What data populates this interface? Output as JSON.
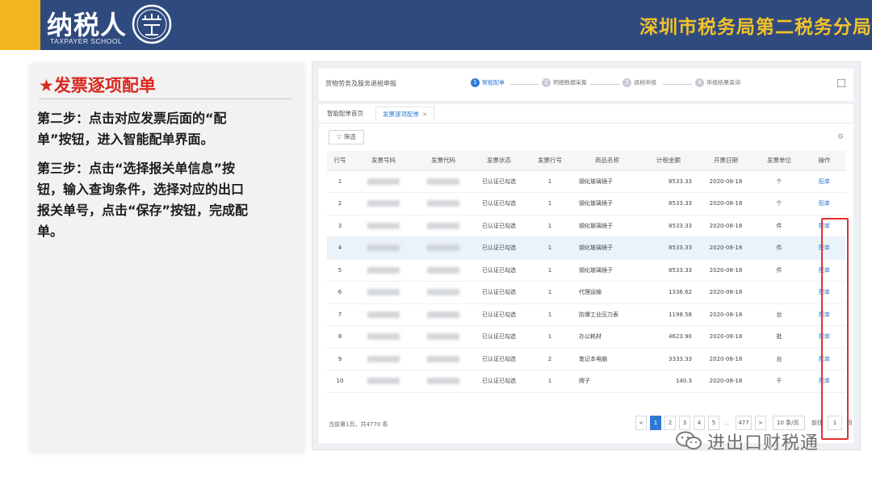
{
  "header": {
    "logo_text": "纳税人",
    "logo_sub": "TAXPAYER SCHOOL",
    "seal_char": "学堂",
    "bureau": "深圳市税务局第二税务分局"
  },
  "card": {
    "title": "★发票逐项配单",
    "step1": "第二步：点击对应发票后面的“配单”按钮，进入智能配单界面。",
    "step2": "第三步：点击“选择报关单信息”按钮，输入查询条件，选择对应的出口报关单号，点击“保存”按钮，完成配单。"
  },
  "app": {
    "crumb_title": "货物劳务及服务退税申报",
    "steps": [
      {
        "num": "1",
        "label": "智能配单"
      },
      {
        "num": "2",
        "label": "明细数据采集"
      },
      {
        "num": "3",
        "label": "退税申报"
      },
      {
        "num": "4",
        "label": "申报结果查询"
      }
    ],
    "tabs": {
      "home": "智能配单首页",
      "current": "发票逐项配单",
      "close": "×"
    },
    "filter_label": "筛选",
    "columns": [
      "行号",
      "发票号码",
      "发票代码",
      "发票状态",
      "发票行号",
      "商品名称",
      "计税金额",
      "开票日期",
      "发票单位",
      "操作"
    ],
    "rows": [
      {
        "no": "1",
        "status": "已认证已勾选",
        "line": "1",
        "name": "钢化玻璃镜子",
        "amount": "8533.33",
        "date": "2020-08-18",
        "unit": "个",
        "op": "配单"
      },
      {
        "no": "2",
        "status": "已认证已勾选",
        "line": "1",
        "name": "钢化玻璃镜子",
        "amount": "8533.33",
        "date": "2020-08-18",
        "unit": "个",
        "op": "配单"
      },
      {
        "no": "3",
        "status": "已认证已勾选",
        "line": "1",
        "name": "钢化玻璃镜子",
        "amount": "8533.33",
        "date": "2020-08-18",
        "unit": "件",
        "op": "配单"
      },
      {
        "no": "4",
        "status": "已认证已勾选",
        "line": "1",
        "name": "钢化玻璃镜子",
        "amount": "8533.33",
        "date": "2020-08-18",
        "unit": "件",
        "op": "配单"
      },
      {
        "no": "5",
        "status": "已认证已勾选",
        "line": "1",
        "name": "钢化玻璃镜子",
        "amount": "8533.33",
        "date": "2020-08-18",
        "unit": "件",
        "op": "配单"
      },
      {
        "no": "6",
        "status": "已认证已勾选",
        "line": "1",
        "name": "代理运输",
        "amount": "1336.62",
        "date": "2020-08-18",
        "unit": "",
        "op": "配单"
      },
      {
        "no": "7",
        "status": "已认证已勾选",
        "line": "1",
        "name": "防爆工业压力表",
        "amount": "1198.58",
        "date": "2020-08-18",
        "unit": "台",
        "op": "配单"
      },
      {
        "no": "8",
        "status": "已认证已勾选",
        "line": "1",
        "name": "办公耗材",
        "amount": "4623.90",
        "date": "2020-08-18",
        "unit": "批",
        "op": "配单"
      },
      {
        "no": "9",
        "status": "已认证已勾选",
        "line": "2",
        "name": "笔记本电脑",
        "amount": "3333.33",
        "date": "2020-08-18",
        "unit": "台",
        "op": "配单"
      },
      {
        "no": "10",
        "status": "已认证已勾选",
        "line": "1",
        "name": "牌子",
        "amount": "140.3",
        "date": "2020-08-18",
        "unit": "千",
        "op": "配单"
      }
    ],
    "highlight_row": 4,
    "footer_total": "当前第1页，共4770 条",
    "pager": {
      "prev": "<",
      "pages": [
        "1",
        "2",
        "3",
        "4",
        "5"
      ],
      "dots": "...",
      "last": "477",
      "next": ">",
      "size": "10 条/页",
      "goto": "前往",
      "goto_value": "1",
      "unit": "页"
    }
  },
  "watermark": "进出口财税通",
  "colors": {
    "header_bg": "#2f4a7e",
    "accent": "#f3b51f",
    "title_red": "#d9281e",
    "link_blue": "#2f7ad6",
    "highlight_box": "#e23030"
  }
}
